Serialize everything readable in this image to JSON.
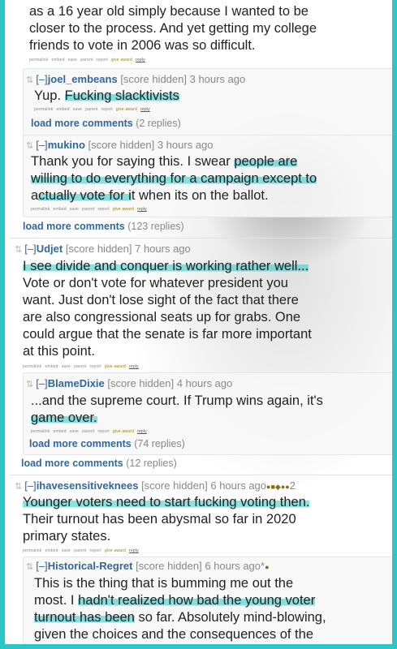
{
  "comments": {
    "c0": {
      "line1": "as a 16 year old simply because I wanted to be",
      "line2": "closer to the process. And yet getting my college",
      "line3": "friends to vote in 2006 was so difficult."
    },
    "c1": {
      "toggle": "[–]",
      "user": "joel_embeans",
      "score": "[score hidden]",
      "time": "3 hours ago",
      "body_a": "Yup. ",
      "body_hl": "Fucking slacktivists"
    },
    "c2": {
      "toggle": "[–]",
      "user": "mukino",
      "score": "[score hidden]",
      "time": "3 hours ago",
      "l1_a": "Thank you for saying this. I swear ",
      "l1_hl": "people are",
      "l2_hl": "willing to do everything for a campaign except to",
      "l3_a": "a",
      "l3_hl": "ctually vote for i",
      "l3_b": "t when its on the ballot."
    },
    "c3": {
      "toggle": "[–]",
      "user": "Udjet",
      "score": "[score hidden]",
      "time": "7 hours ago",
      "l1_hl": "I see divide and conquer is working rather well...",
      "l2": "Vote or don't vote for whatever president you",
      "l3": "want. Just don't lose sight of the fact that there",
      "l4": "are also congressional seats up for grabs. One",
      "l5": "could argue that the senate is far more important",
      "l6": "at this point."
    },
    "c4": {
      "toggle": "[–]",
      "user": "BlameDixie",
      "score": "[score hidden]",
      "time": "4 hours ago",
      "l1": "...and the supreme court. If Trump wins again, it's",
      "l2_hl": "game over."
    },
    "c5": {
      "toggle": "[–]",
      "user": "ihavesensitiveknees",
      "score": "[score hidden]",
      "time": "6 hours ago",
      "award_count": "2",
      "l1_hl": "Younger voters need to start fucking voting then.",
      "l2": "Their turnout has been abysmal so far in 2020",
      "l3": "primary states."
    },
    "c6": {
      "toggle": "[–]",
      "user": "Historical-Regret",
      "score": "[score hidden]",
      "time": "6 hours ago",
      "edited": "*",
      "l1": "This is the thing that is bumming me out the",
      "l2_a": "most. I ",
      "l2_hl": "hadn't realized how bad the young voter",
      "l3_hl": "turnout has been",
      "l3_b": " so far. Absolutely mind-blowing,",
      "l4": "given the choices and the consequences of the"
    }
  },
  "links": {
    "permalink": "permalink",
    "embed": "embed",
    "save": "save",
    "parent": "parent",
    "report": "report",
    "give_award": "give award",
    "reply": "reply"
  },
  "more": {
    "m1_label": "load more comments",
    "m1_count": "(2 replies)",
    "m2_label": "load more comments",
    "m2_count": "(123 replies)",
    "m3_label": "load more comments",
    "m3_count": "(74 replies)",
    "m4_label": "load more comments",
    "m4_count": "(12 replies)"
  },
  "colors": {
    "frame": "#2cc6c6",
    "highlight": "#2dc8c8",
    "username": "#336699"
  }
}
